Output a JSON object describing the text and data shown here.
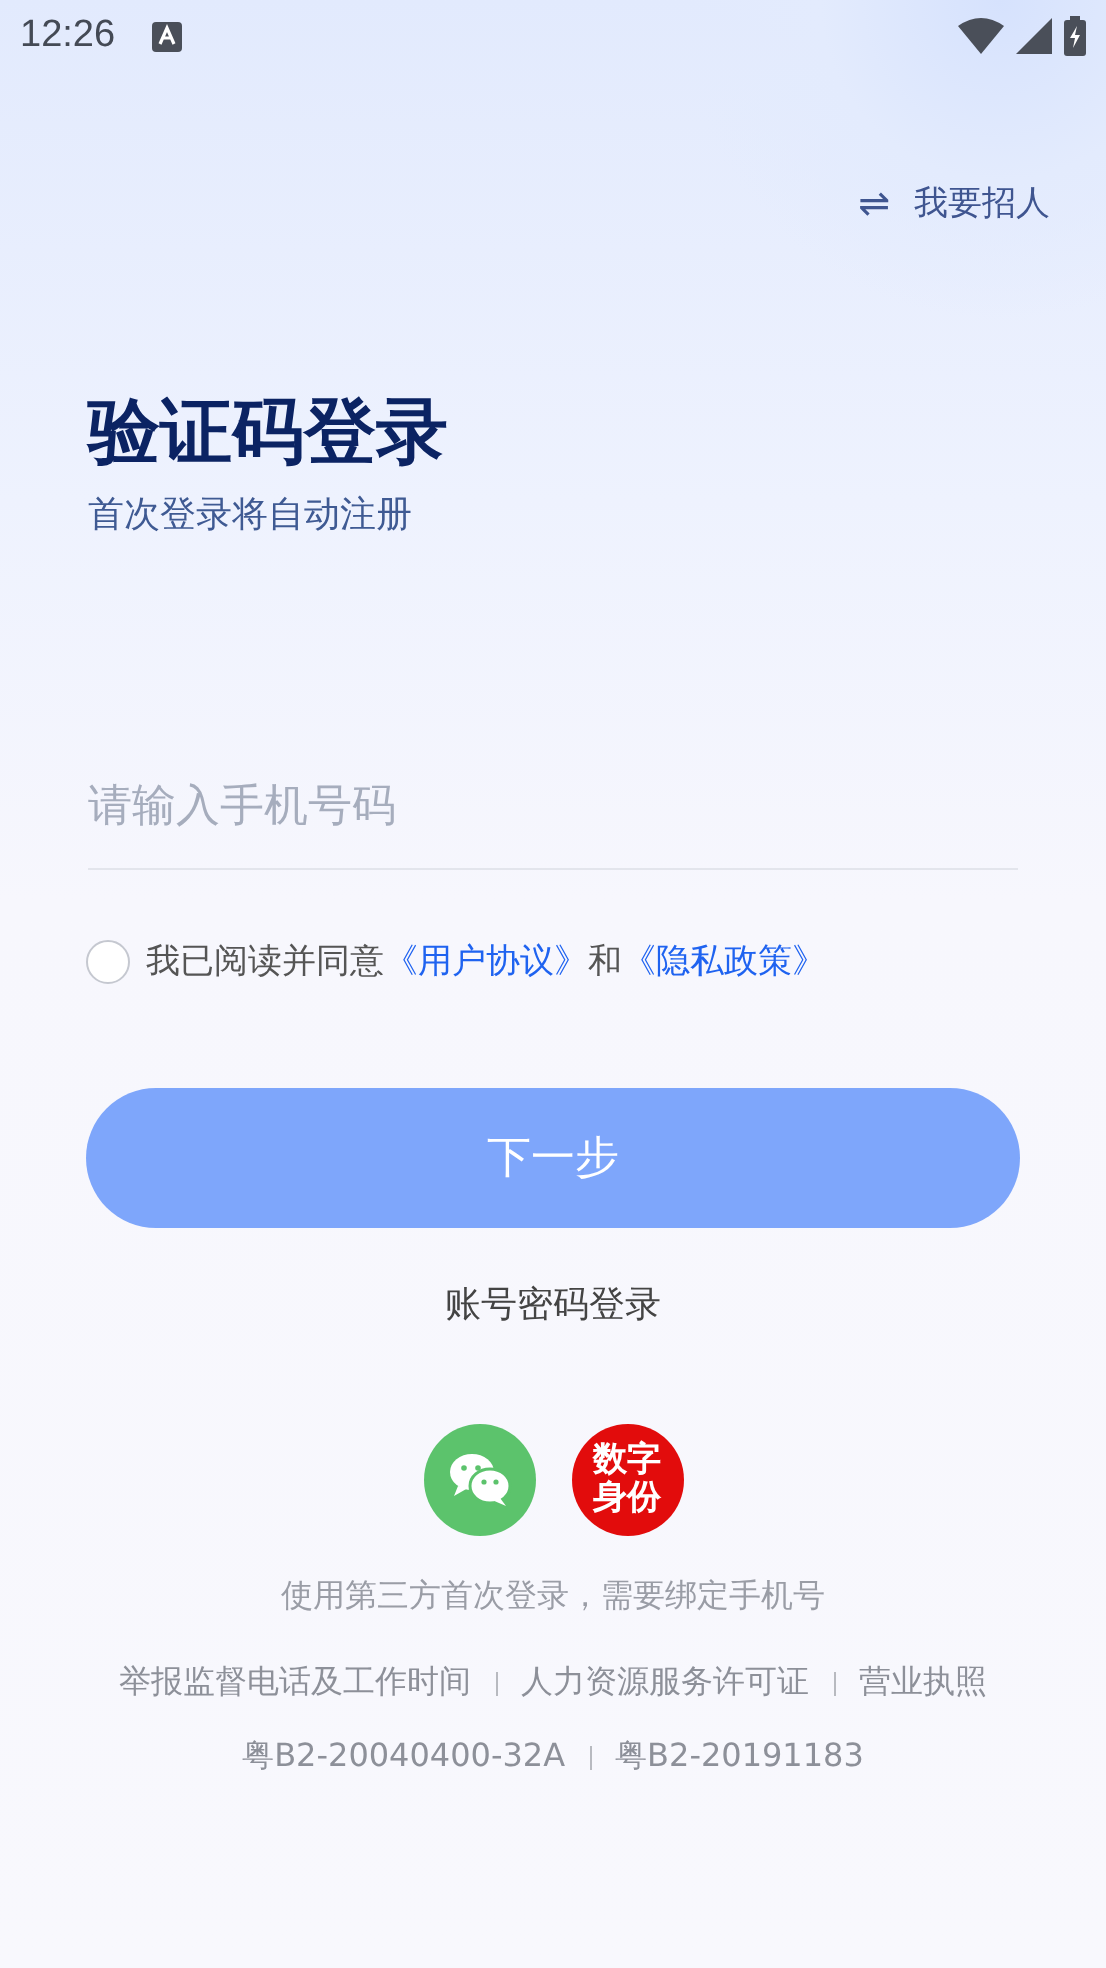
{
  "status_bar": {
    "time": "12:26"
  },
  "switch_link": {
    "icon": "⇌",
    "label": "我要招人"
  },
  "title": "验证码登录",
  "subtitle": "首次登录将自动注册",
  "phone_field": {
    "placeholder": "请输入手机号码"
  },
  "agreement": {
    "checked": false,
    "text": "我已阅读并同意",
    "link_1": "《用户协议》",
    "joiner": "和",
    "link_2": "《隐私政策》"
  },
  "next_button": {
    "label": "下一步",
    "disabled": true
  },
  "password_login": "账号密码登录",
  "third_party": [
    {
      "kind": "wechat"
    },
    {
      "kind": "digital_id",
      "label": "数字身份"
    }
  ],
  "third_party_note": "使用第三方首次登录，需要绑定手机号",
  "footer_links": [
    "举报监督电话及工作时间",
    "人力资源服务许可证",
    "营业执照"
  ],
  "licenses": [
    "粤B2-20040400-32A",
    "粤B2-20191183"
  ]
}
